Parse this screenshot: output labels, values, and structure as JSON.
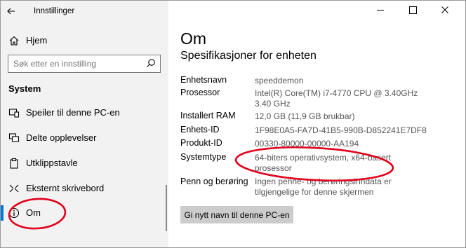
{
  "window": {
    "title": "Innstillinger",
    "controls": {
      "minimize": "—",
      "maximize": "☐",
      "close": "✕"
    }
  },
  "sidebar": {
    "home_label": "Hjem",
    "search_placeholder": "Søk etter en innstilling",
    "section_title": "System",
    "items": [
      {
        "label": "Speiler til denne PC-en",
        "icon": "project-icon"
      },
      {
        "label": "Delte opplevelser",
        "icon": "shared-experiences-icon"
      },
      {
        "label": "Utklippstavle",
        "icon": "clipboard-icon"
      },
      {
        "label": "Eksternt skrivebord",
        "icon": "remote-desktop-icon"
      },
      {
        "label": "Om",
        "icon": "info-icon",
        "selected": true
      }
    ]
  },
  "main": {
    "title": "Om",
    "subtitle": "Spesifikasjoner for enheten",
    "specs": [
      {
        "label": "Enhetsnavn",
        "value": "speeddemon"
      },
      {
        "label": "Prosessor",
        "value": "Intel(R) Core(TM) i7-4770 CPU @ 3.40GHz",
        "value2": "3.40 GHz"
      },
      {
        "label": "Installert RAM",
        "value": "12,0 GB (11,9 GB brukbar)"
      },
      {
        "label": "Enhets-ID",
        "value": "1F98E0A5-FA7D-41B5-990B-D852241E7DF8"
      },
      {
        "label": "Produkt-ID",
        "value": "00330-80000-00000-AA194"
      },
      {
        "label": "Systemtype",
        "value": "64-biters operativsystem, x64-basert",
        "value2": "prosessor"
      },
      {
        "label": "Penn og berøring",
        "value": "Ingen penne- og berøringsinndata er",
        "value2": "tilgjengelige for denne skjermen"
      }
    ],
    "rename_button": "Gi nytt navn til denne PC-en"
  },
  "colors": {
    "accent": "#0078d7",
    "annotation": "#e0001b",
    "sidebar_bg": "#f2f2f2",
    "button_bg": "#cccccc"
  }
}
